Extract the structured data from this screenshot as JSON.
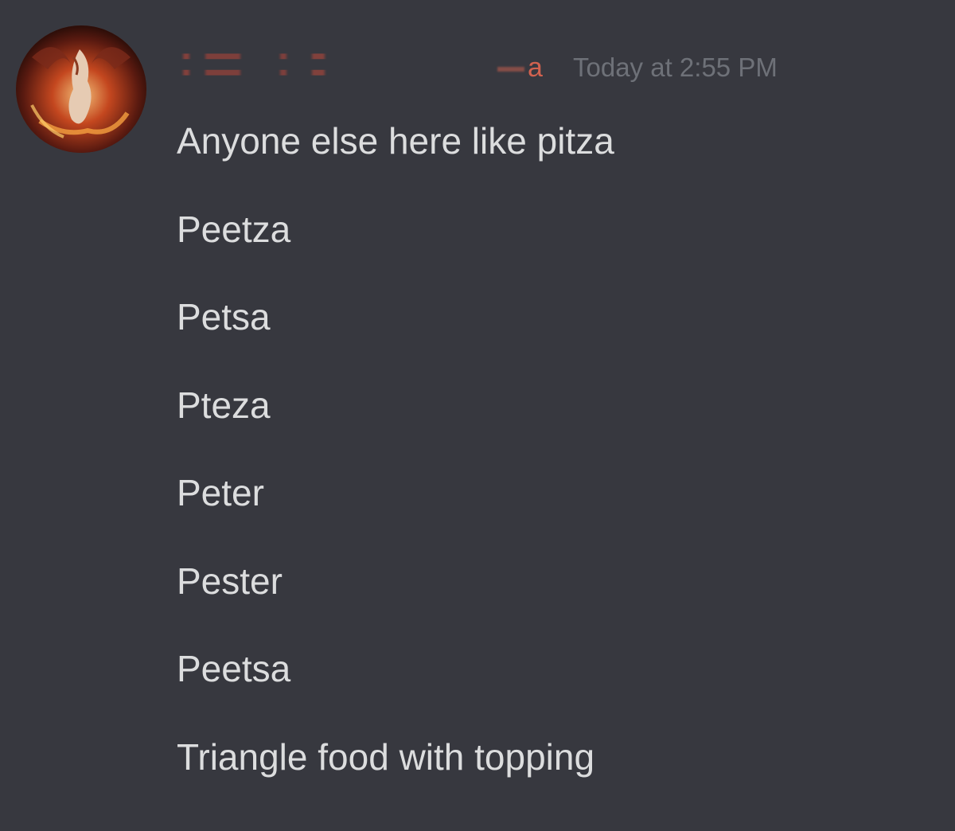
{
  "author": {
    "name_visible_fragment": "a",
    "name_color": "#d2624f",
    "avatar_icon": "dragon-avatar"
  },
  "timestamp": "Today at 2:55 PM",
  "messages": [
    "Anyone else here like pitza",
    "Peetza",
    "Petsa",
    "Pteza",
    "Peter",
    "Pester",
    "Peetsa",
    "Triangle food with topping"
  ],
  "colors": {
    "background": "#37383f",
    "message_text": "#dcddde",
    "timestamp_text": "#6e7178"
  }
}
